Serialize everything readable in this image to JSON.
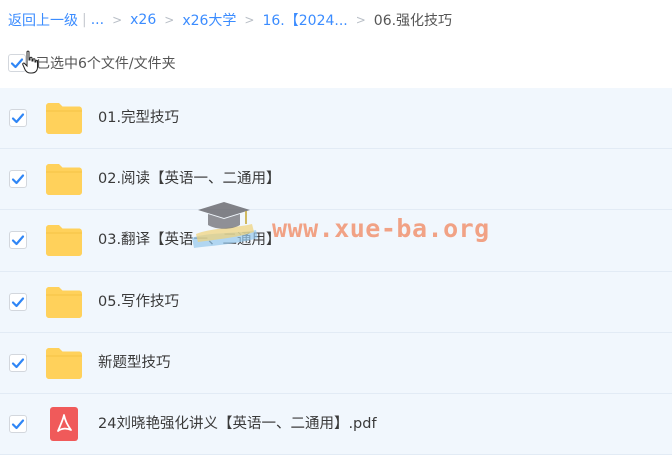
{
  "breadcrumb": {
    "back": "返回上一级",
    "ellipsis": "...",
    "items": [
      "x26",
      "x26大学",
      "16.【2024..."
    ],
    "current": "06.强化技巧"
  },
  "selection": {
    "label": "已选中6个文件/文件夹"
  },
  "files": [
    {
      "name": "01.完型技巧",
      "type": "folder-icon"
    },
    {
      "name": "02.阅读【英语一、二通用】",
      "type": "folder-icon"
    },
    {
      "name": "03.翻译【英语一、二通用】",
      "type": "folder-icon"
    },
    {
      "name": "05.写作技巧",
      "type": "folder-icon"
    },
    {
      "name": "新题型技巧",
      "type": "folder-icon"
    },
    {
      "name": "24刘晓艳强化讲义【英语一、二通用】.pdf",
      "type": "pdf-icon"
    }
  ],
  "watermark": {
    "text": "www.xue-ba.org"
  },
  "colors": {
    "accent": "#3b8cff",
    "folder": "#ffd15b",
    "pdf": "#f05a5a",
    "row_bg": "#f1f7fd",
    "watermark": "#f06e3c"
  }
}
